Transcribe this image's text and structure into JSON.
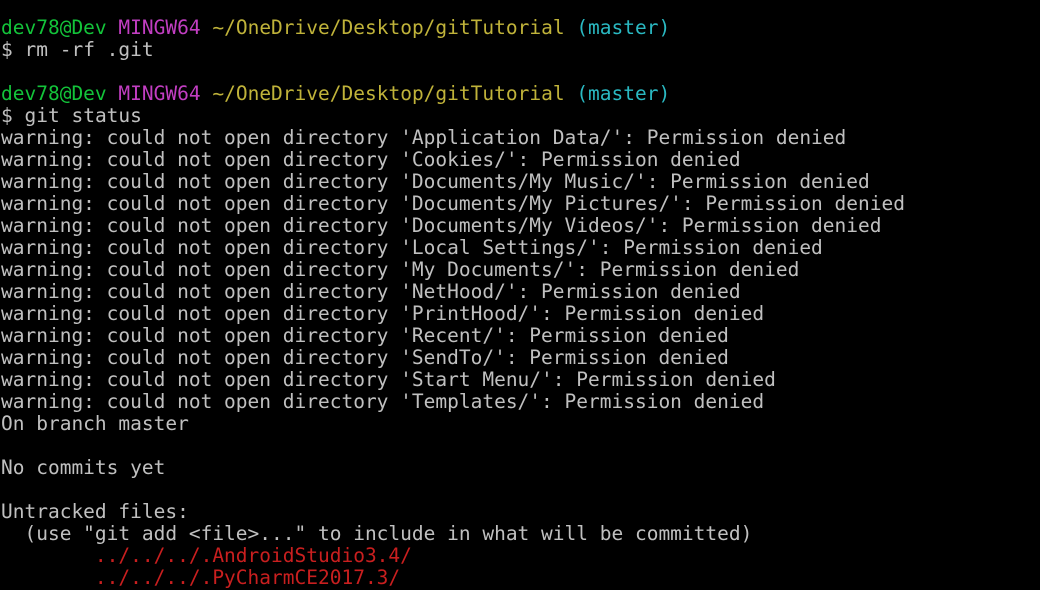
{
  "prompt": {
    "user_host": "dev78@Dev",
    "shell": "MINGW64",
    "path": "~/OneDrive/Desktop/gitTutorial",
    "branch": "(master)",
    "symbol": "$"
  },
  "commands": [
    "rm -rf .git",
    "git status"
  ],
  "warnings": [
    "warning: could not open directory 'Application Data/': Permission denied",
    "warning: could not open directory 'Cookies/': Permission denied",
    "warning: could not open directory 'Documents/My Music/': Permission denied",
    "warning: could not open directory 'Documents/My Pictures/': Permission denied",
    "warning: could not open directory 'Documents/My Videos/': Permission denied",
    "warning: could not open directory 'Local Settings/': Permission denied",
    "warning: could not open directory 'My Documents/': Permission denied",
    "warning: could not open directory 'NetHood/': Permission denied",
    "warning: could not open directory 'PrintHood/': Permission denied",
    "warning: could not open directory 'Recent/': Permission denied",
    "warning: could not open directory 'SendTo/': Permission denied",
    "warning: could not open directory 'Start Menu/': Permission denied",
    "warning: could not open directory 'Templates/': Permission denied"
  ],
  "status": {
    "branch_line": "On branch master",
    "commits_line": "No commits yet",
    "untracked_header": "Untracked files:",
    "hint": "  (use \"git add <file>...\" to include in what will be committed)",
    "untracked": [
      "        ../../../.AndroidStudio3.4/",
      "        ../../../.PyCharmCE2017.3/"
    ]
  },
  "colors": {
    "background": "#000000",
    "user_host": "#13c43a",
    "shell": "#c23ec2",
    "path": "#c0b33a",
    "branch": "#2ab9c2",
    "text": "#c0c0c0",
    "untracked": "#c91f1f"
  }
}
